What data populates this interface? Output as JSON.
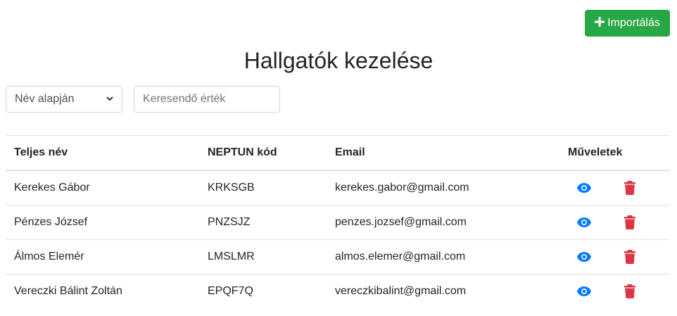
{
  "header": {
    "import_label": "Importálás",
    "title": "Hallgatók kezelése"
  },
  "filter": {
    "selected": "Név alapján",
    "search_placeholder": "Keresendő érték"
  },
  "table": {
    "columns": [
      "Teljes név",
      "NEPTUN kód",
      "Email",
      "Műveletek"
    ],
    "rows": [
      {
        "name": "Kerekes Gábor",
        "code": "KRKSGB",
        "email": "kerekes.gabor@gmail.com"
      },
      {
        "name": "Pénzes József",
        "code": "PNZSJZ",
        "email": "penzes.jozsef@gmail.com"
      },
      {
        "name": "Álmos Elemér",
        "code": "LMSLMR",
        "email": "almos.elemer@gmail.com"
      },
      {
        "name": "Vereczki Bálint Zoltán",
        "code": "EPQF7Q",
        "email": "vereczkibalint@gmail.com"
      }
    ]
  },
  "icons": {
    "import": "plus-icon",
    "view": "eye-icon",
    "delete": "trash-icon",
    "select": "chevron-down-icon"
  },
  "colors": {
    "import_button": "#28a745",
    "view_icon": "#007bff",
    "delete_icon": "#dc3545"
  }
}
